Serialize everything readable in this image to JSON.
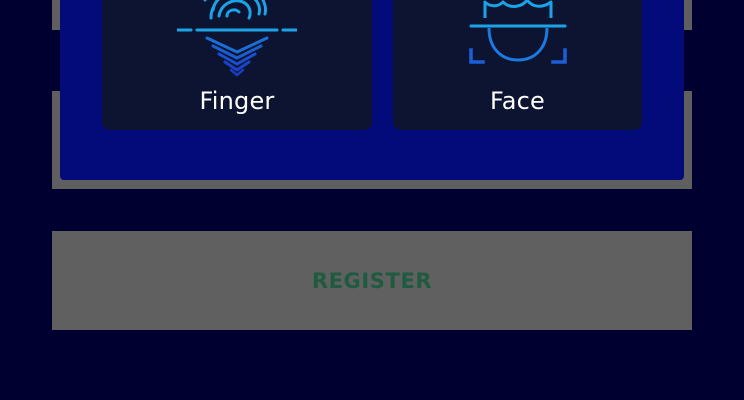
{
  "options": [
    {
      "label": "Finger",
      "icon": "fingerprint-icon"
    },
    {
      "label": "Face",
      "icon": "face-scan-icon"
    }
  ],
  "register": {
    "label": "REGISTER"
  },
  "colors": {
    "background": "#000030",
    "dialog": "#030a7a",
    "card": "#0d1432",
    "icon_light": "#1aa3e6",
    "icon_dark": "#1a4fd1",
    "button": "#606060",
    "button_text": "#1e5b40"
  }
}
